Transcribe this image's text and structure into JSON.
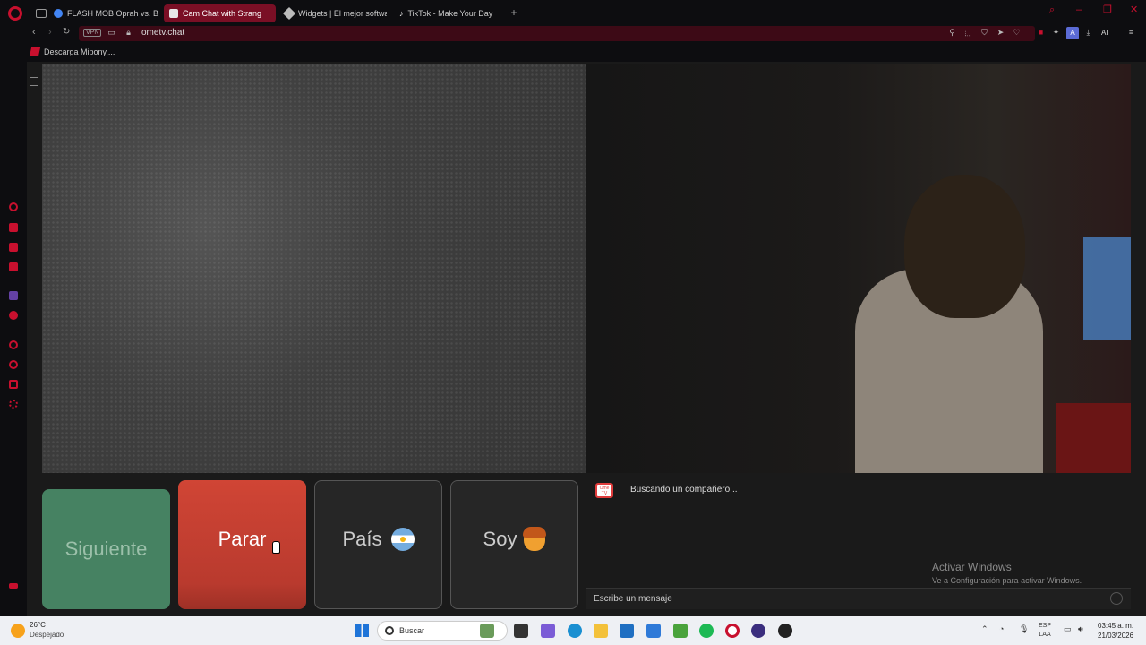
{
  "browser": {
    "tabs": [
      {
        "title": "FLASH MOB Oprah vs. Bla",
        "active": false,
        "favicon_color": "#4285f4"
      },
      {
        "title": "Cam Chat with Strang",
        "active": true,
        "favicon_color": "#e8e8e8"
      },
      {
        "title": "Widgets | El mejor softwa",
        "active": false,
        "favicon_color": "#bbbbbb"
      },
      {
        "title": "TikTok - Make Your Day",
        "active": false,
        "favicon_color": "#ffffff"
      }
    ],
    "add_tab": "+",
    "address": {
      "vpn_badge": "VPN",
      "url": "ometv.chat",
      "account_initial": "A",
      "ai_label": "AI"
    },
    "bookmarks": [
      {
        "label": "Descarga Mipony,..."
      }
    ]
  },
  "app": {
    "buttons": {
      "next": "Siguiente",
      "stop": "Parar",
      "country": "País",
      "gender": "Soy"
    },
    "chat": {
      "logo_text": "Ome TV",
      "status": "Buscando un compañero...",
      "input_placeholder": "Escribe un mensaje"
    },
    "watermark": {
      "line1": "Activar Windows",
      "line2": "Ve a Configuración para activar Windows."
    }
  },
  "taskbar": {
    "weather": {
      "temp": "26°C",
      "condition": "Despejado"
    },
    "search_placeholder": "Buscar",
    "lang": {
      "line1": "ESP",
      "line2": "LAA"
    },
    "clock": {
      "time": "03:45 a. m.",
      "date": "21/03/2026"
    }
  },
  "colors": {
    "brand_red": "#c8102e",
    "next_green": "#468262",
    "stop_red": "#c43f31"
  }
}
